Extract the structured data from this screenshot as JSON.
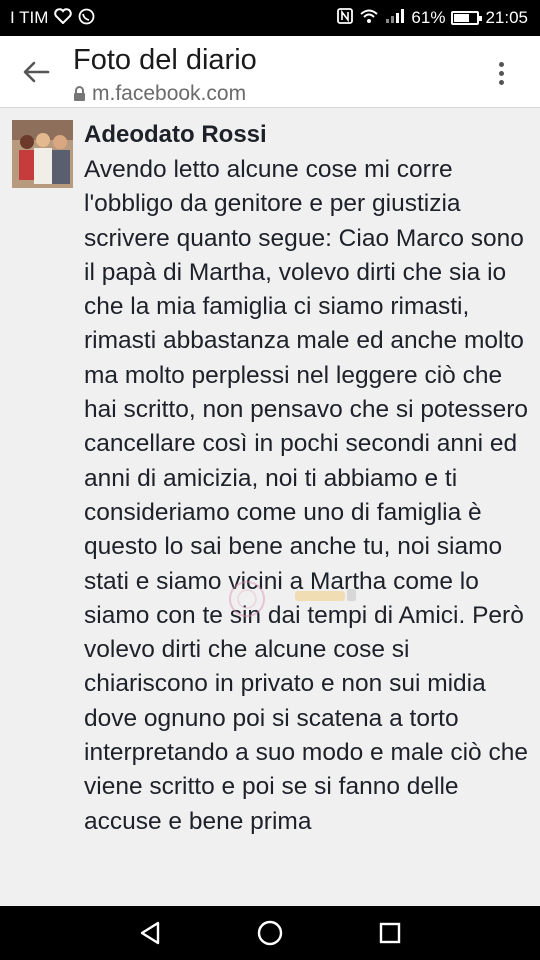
{
  "status_bar": {
    "carrier": "I TIM",
    "battery": "61%",
    "time": "21:05",
    "battery_level": 0.61
  },
  "app_bar": {
    "title": "Foto del diario",
    "url": "m.facebook.com"
  },
  "post": {
    "author": "Adeodato Rossi",
    "text": "Avendo letto alcune cose mi corre l'obbligo da genitore e per giustizia scrivere quanto segue: Ciao Marco sono il papà di Martha, volevo dirti che sia io che la mia famiglia ci siamo rimasti, rimasti abbastanza male ed anche molto ma molto perplessi nel leggere ciò che hai scritto, non pensavo che si potessero cancellare così in pochi secondi anni ed anni di amicizia, noi ti abbiamo e ti consideriamo come uno di famiglia è questo lo sai bene anche tu, noi siamo stati e siamo vicini a Martha come lo siamo con te sin dai tempi di Amici. Però volevo dirti che alcune cose si chiariscono in privato e non sui midia dove ognuno poi si scatena a torto interpretando a suo modo e male ciò che viene scritto e poi se si fanno delle accuse e bene prima"
  },
  "icons": {
    "back": "arrow-left-icon",
    "lock": "lock-icon",
    "menu": "more-vert-icon",
    "nav_back": "triangle-back-icon",
    "nav_home": "circle-home-icon",
    "nav_recents": "square-recents-icon"
  }
}
